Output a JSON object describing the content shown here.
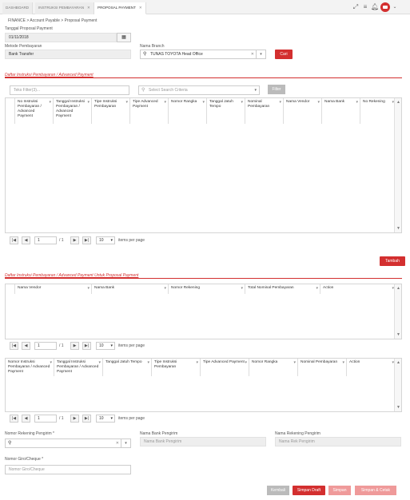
{
  "tabs": [
    {
      "label": "DASHBOARD",
      "closable": false
    },
    {
      "label": "INSTRUKSI PEMBAYARAN",
      "closable": true
    },
    {
      "label": "PROPOSAL PAYMENT",
      "closable": true
    }
  ],
  "breadcrumb": {
    "path": "FINANCE > Account Payable > Proposal Payment"
  },
  "form": {
    "tanggal_label": "Tanggal Proposal Payment",
    "tanggal_value": "01/11/2018",
    "metode_label": "Metode Pembayaran",
    "metode_value": "Bank Transfer",
    "branch_label": "Nama Branch",
    "branch_value": "TUNAS TOYOTA Head Office",
    "cari_label": "Cari"
  },
  "section1": {
    "title": "Daftar Instruksi Pembayaran / Advanced Payment",
    "filter_placeholder": "Teks Filter(3)...",
    "criteria_placeholder": "Select Search Criteria",
    "filter_button": "Filter",
    "columns": [
      "No Instruksi Pembayaran / Advanced Payment",
      "Tanggal Instruksi Pembayaran / Advanced Payment",
      "Tipe Instruksi Pembayaran",
      "Tipe Advanced Payment",
      "Nomor Rangka",
      "Tanggal Jatuh Tempo",
      "Nominal Pembayaran",
      "Nama Vendor",
      "Nama Bank",
      "No Rekening"
    ],
    "page": "1",
    "of_pages": "/ 1",
    "page_size": "10",
    "items_per_page": "items per page",
    "tambah_label": "Tambah"
  },
  "section2": {
    "title": "Daftar Instruksi Pembayaran / Advanced Payment Untuk Proposal Payment",
    "columns": [
      "Nama Vendor",
      "Nama Bank",
      "Nomor Rekening",
      "Total Nominal Pembayaran",
      "Action"
    ],
    "page": "1",
    "of_pages": "/ 1",
    "page_size": "10",
    "items_per_page": "items per page"
  },
  "section3": {
    "columns": [
      "Nomor Instruksi Pembayaran / Advanced Payment",
      "Tanggal Instruksi Pembayaran / Advanced Payment",
      "Tanggal Jatuh Tempo",
      "Tipe Instruksi Pembayaran",
      "Tipe Advanced Payment",
      "Nomor Rangka",
      "Nominal Pembayaran",
      "Action"
    ],
    "page": "1",
    "of_pages": "/ 1",
    "page_size": "10",
    "items_per_page": "items per page"
  },
  "pengirim": {
    "rekening_label": "Nomor Rekening Pengirim *",
    "bank_label": "Nama Bank Pengirim",
    "bank_placeholder": "Nama Bank Pengirim",
    "nama_rek_label": "Nama Rekening Pengirim",
    "nama_rek_placeholder": "Nama Rek Pengirim",
    "giro_label": "Nomor Giro/Cheque *",
    "giro_placeholder": "Nomor Giro/Cheque"
  },
  "actions": {
    "kembali": "Kembali",
    "simpan_draft": "Simpan Draft",
    "simpan": "Simpan",
    "simpan_cetak": "Simpan & Cetak"
  },
  "colors": {
    "accent": "#d32f2f",
    "accent_light": "#ef9a9a"
  }
}
